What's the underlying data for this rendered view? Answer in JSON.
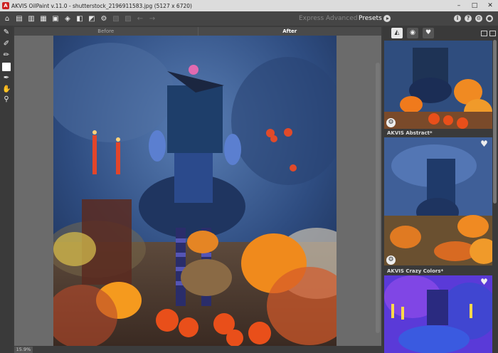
{
  "window": {
    "title": "AKVIS OilPaint v.11.0 - shutterstock_2196911583.jpg (5127 x 6720)",
    "logo_text": "A",
    "controls": [
      "–",
      "□",
      "✕"
    ]
  },
  "toolbar": {
    "icons": [
      "home-icon",
      "open-file-icon",
      "save-file-icon",
      "print-icon",
      "batch-icon",
      "share-icon",
      "plugin-icon",
      "before-after-icon",
      "settings-icon",
      "undo-icon",
      "redo-icon"
    ],
    "modes": {
      "express": "Express",
      "advanced": "Advanced",
      "presets": "Presets"
    },
    "right_icons": {
      "info": "i",
      "help": "?",
      "settings": "⚙",
      "notifications": "●"
    }
  },
  "tabs": {
    "before": "Before",
    "after": "After"
  },
  "status": {
    "zoom": "15.9%"
  },
  "presets": [
    {
      "label": "AKVIS Abstract*"
    },
    {
      "label": "AKVIS Crazy Colors*"
    }
  ],
  "colors": {
    "accent": "#e8e8e8",
    "bg": "#3c3c3c",
    "panel": "#3a3a3a"
  }
}
